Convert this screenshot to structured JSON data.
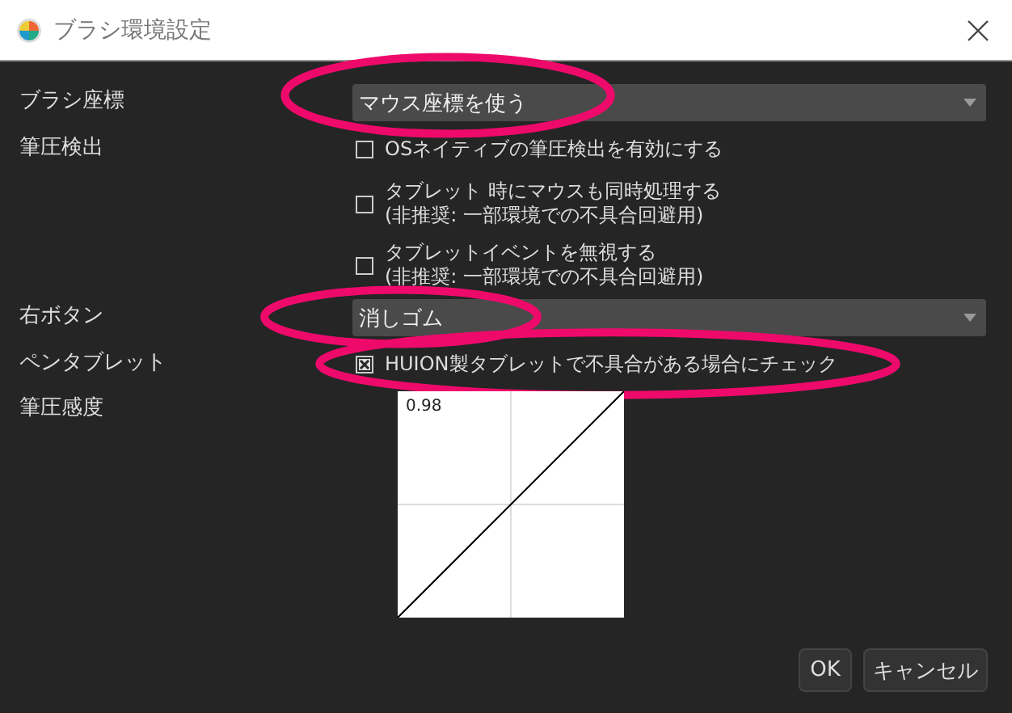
{
  "window": {
    "title": "ブラシ環境設定"
  },
  "settings": [
    {
      "kind": "dropdown",
      "label": "ブラシ座標",
      "value": "マウス座標を使う",
      "highlighted": true
    },
    {
      "kind": "checkboxes",
      "label": "筆圧検出",
      "options": [
        {
          "lines": [
            "OSネイティブの筆圧検出を有効にする"
          ],
          "checked": false,
          "highlighted": false
        },
        {
          "lines": [
            "タブレット 時にマウスも同時処理する",
            "(非推奨: 一部環境での不具合回避用)"
          ],
          "checked": false,
          "highlighted": false
        },
        {
          "lines": [
            "タブレットイベントを無視する",
            "(非推奨: 一部環境での不具合回避用)"
          ],
          "checked": false,
          "highlighted": false
        }
      ]
    },
    {
      "kind": "dropdown",
      "label": "右ボタン",
      "value": "消しゴム",
      "highlighted": true
    },
    {
      "kind": "checkboxes",
      "label": "ペンタブレット",
      "options": [
        {
          "lines": [
            "HUION製タブレットで不具合がある場合にチェック"
          ],
          "checked": true,
          "highlighted": true
        }
      ]
    },
    {
      "kind": "curve",
      "label": "筆圧感度",
      "reading": "0.98"
    }
  ],
  "buttons": [
    {
      "label": "OK"
    },
    {
      "label": "キャンセル"
    }
  ]
}
